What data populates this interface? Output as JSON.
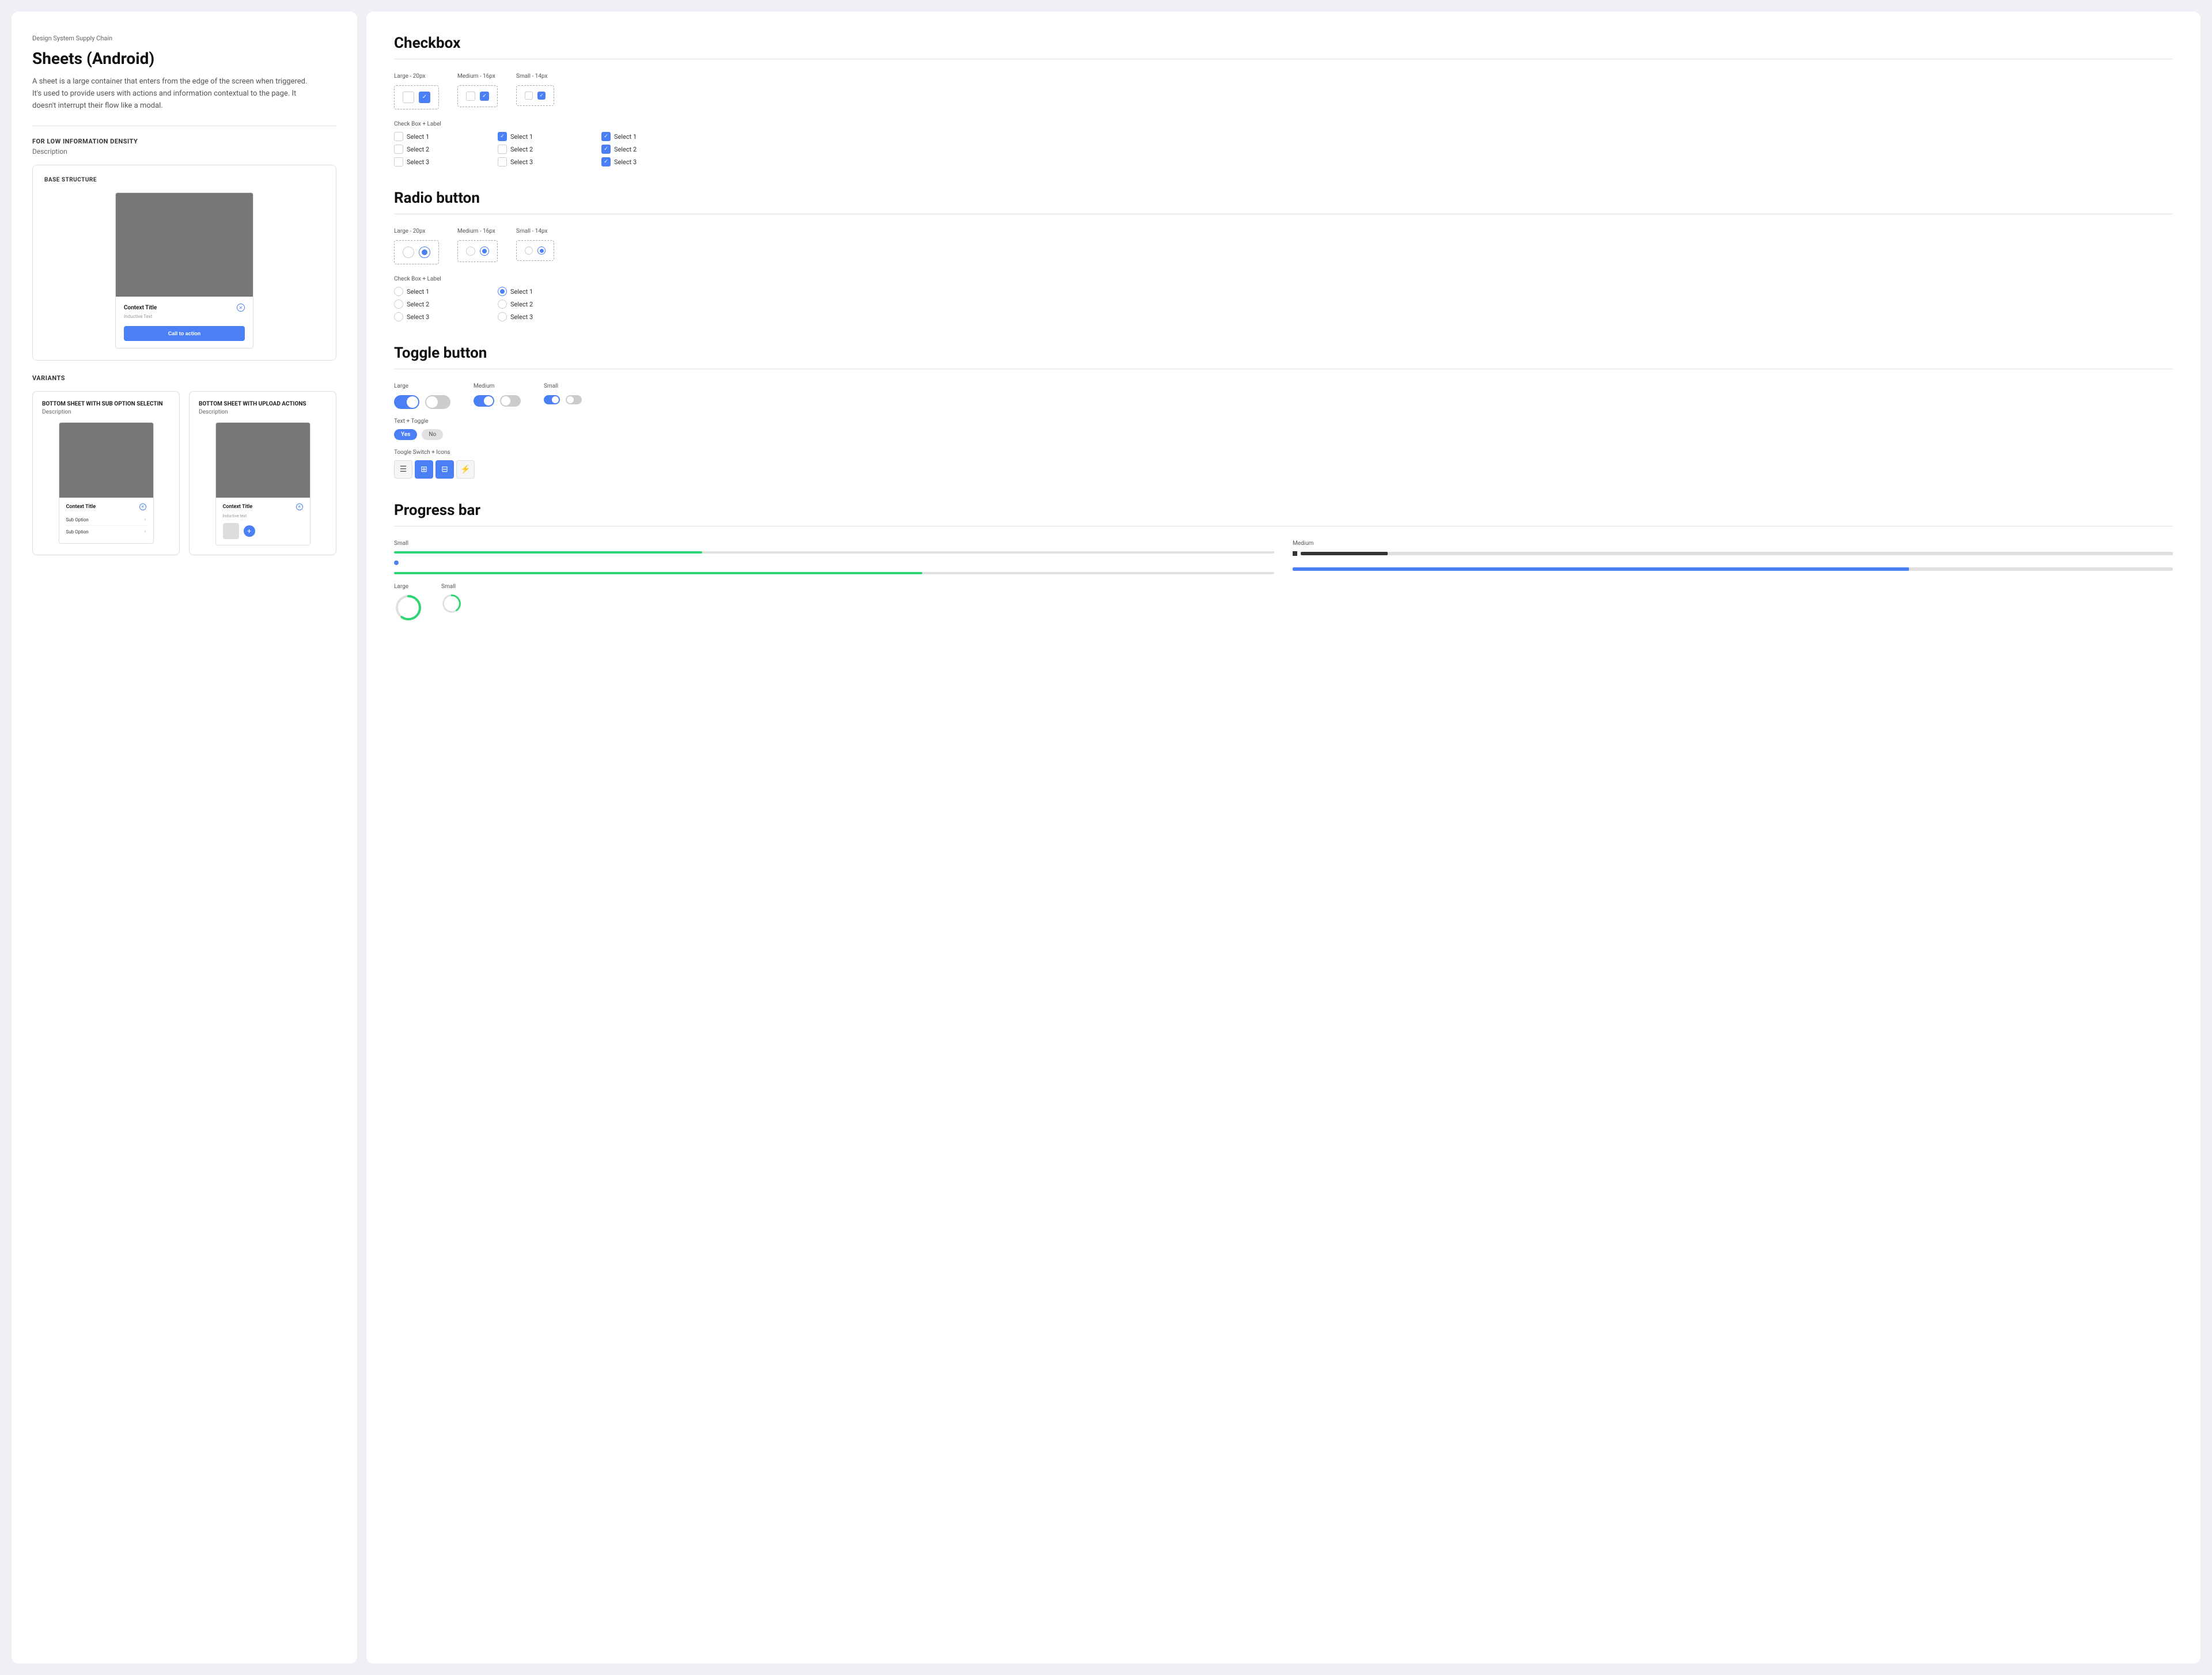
{
  "left": {
    "breadcrumb": "Design System Supply Chain",
    "title": "Sheets (Android)",
    "description": "A sheet is a large container that enters from the edge of the screen when triggered. It's used to provide users with actions and information contextual to the page. It doesn't interrupt their flow like a modal.",
    "for_low": {
      "label": "FOR LOW INFORMATION DENSITY",
      "desc": "Description",
      "base_structure": {
        "title": "BASE STRUCTURE",
        "sheet": {
          "context_title": "Context Title",
          "inductive_text": "Inductive Text",
          "cta": "Call to action"
        }
      }
    },
    "variants": {
      "label": "VARIANTS",
      "items": [
        {
          "title": "BOTTOM SHEET WITH SUB OPTION SELECTIN",
          "desc": "Description",
          "sheet": {
            "context_title": "Context Title",
            "options": [
              "Sub Option",
              "Sub Option"
            ]
          }
        },
        {
          "title": "BOTTOM SHEET WITH UPLOAD ACTIONS",
          "desc": "Description",
          "sheet": {
            "context_title": "Context Title",
            "inductive_text": "Inductive text"
          }
        }
      ]
    }
  },
  "right": {
    "checkbox": {
      "title": "Checkbox",
      "sizes": [
        {
          "label": "Large - 20px"
        },
        {
          "label": "Medium - 16px"
        },
        {
          "label": "Small - 14px"
        }
      ],
      "check_label_title": "Check Box + Label",
      "columns": [
        {
          "items": [
            {
              "label": "Select 1",
              "checked": false
            },
            {
              "label": "Select 2",
              "checked": false
            },
            {
              "label": "Select 3",
              "checked": false
            }
          ]
        },
        {
          "items": [
            {
              "label": "Select 1",
              "checked": true
            },
            {
              "label": "Select 2",
              "checked": false
            },
            {
              "label": "Select 3",
              "checked": false
            }
          ]
        },
        {
          "items": [
            {
              "label": "Select 1",
              "checked": true
            },
            {
              "label": "Select 2",
              "checked": true
            },
            {
              "label": "Select 3",
              "checked": true
            }
          ]
        }
      ]
    },
    "radio": {
      "title": "Radio button",
      "sizes": [
        {
          "label": "Large - 20px"
        },
        {
          "label": "Medium - 16px"
        },
        {
          "label": "Small - 14px"
        }
      ],
      "check_label_title": "Check Box + Label",
      "columns": [
        {
          "items": [
            {
              "label": "Select 1",
              "checked": false
            },
            {
              "label": "Select 2",
              "checked": false
            },
            {
              "label": "Select 3",
              "checked": false
            }
          ]
        },
        {
          "items": [
            {
              "label": "Select 1",
              "checked": true
            },
            {
              "label": "Select 2",
              "checked": false
            },
            {
              "label": "Select 3",
              "checked": false
            }
          ]
        }
      ]
    },
    "toggle": {
      "title": "Toggle button",
      "sizes": [
        {
          "label": "Large"
        },
        {
          "label": "Medium"
        },
        {
          "label": "Small"
        }
      ],
      "text_toggle": {
        "label": "Text + Toggle",
        "yes": "Yes",
        "no": "No"
      },
      "icon_toggle": {
        "label": "Toogle Switch + Icons",
        "icons": [
          "☰",
          "⊞",
          "⊟",
          "⚡"
        ]
      }
    },
    "progress": {
      "title": "Progress bar",
      "sizes": [
        {
          "label": "Small",
          "fill": 35
        },
        {
          "label": "Medium",
          "fill": 10
        }
      ],
      "green_fill": 60,
      "blue_fill": 70,
      "circular_label_large": "Large",
      "circular_label_small": "Small"
    }
  }
}
